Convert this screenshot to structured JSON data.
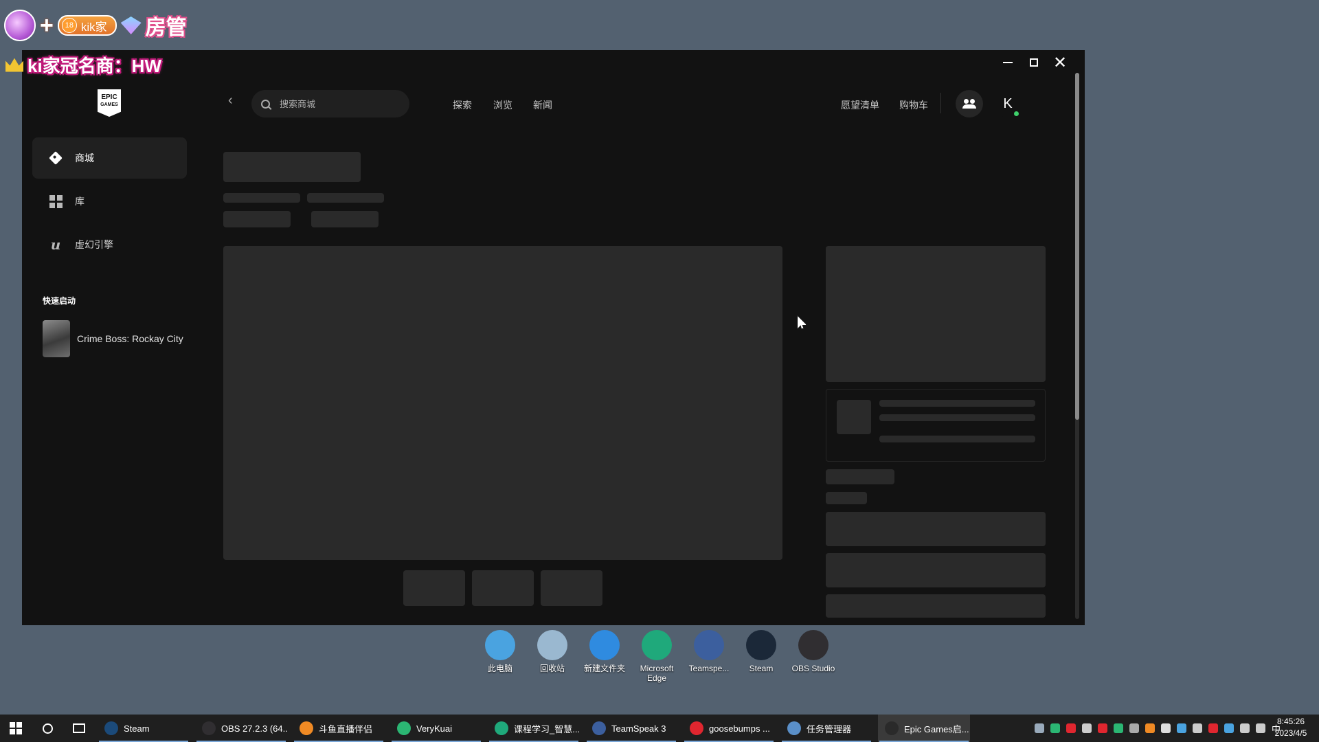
{
  "overlay": {
    "badge_level": "18",
    "badge_name": "kik家",
    "role": "房管",
    "sponsor": "ki家冠名商：HW"
  },
  "window": {
    "controls": {
      "minimize": "minimize",
      "maximize": "maximize",
      "close": "✕"
    }
  },
  "sidebar": {
    "logo_top": "EPIC",
    "logo_bottom": "GAMES",
    "items": [
      {
        "label": "商城",
        "icon": "tag-icon",
        "active": true
      },
      {
        "label": "库",
        "icon": "grid-icon",
        "active": false
      },
      {
        "label": "虚幻引擎",
        "icon": "unreal-icon",
        "active": false
      }
    ],
    "quick_launch_title": "快速启动",
    "quick_launch_items": [
      {
        "name": "Crime Boss: Rockay City"
      }
    ]
  },
  "topbar": {
    "search_placeholder": "搜索商城",
    "nav": [
      "探索",
      "浏览",
      "新闻"
    ],
    "wishlist": "愿望清单",
    "cart": "购物车",
    "avatar_letter": "K",
    "online": true
  },
  "desktop": {
    "icons": [
      {
        "label": "此电脑",
        "icon": "computer-icon",
        "color": "#4aa3e0"
      },
      {
        "label": "回收站",
        "icon": "recycle-bin-icon",
        "color": "#9ab8d0"
      },
      {
        "label": "新建文件夹",
        "icon": "star-folder-icon",
        "color": "#2f8be0"
      },
      {
        "label": "Microsoft Edge",
        "icon": "edge-icon",
        "color": "#1fa97b"
      },
      {
        "label": "Teamspe...",
        "icon": "teamspeak-icon",
        "color": "#3c5f9e"
      },
      {
        "label": "Steam",
        "icon": "steam-icon",
        "color": "#1b2838"
      },
      {
        "label": "OBS Studio",
        "icon": "obs-icon",
        "color": "#302e31"
      }
    ]
  },
  "taskbar": {
    "apps": [
      {
        "label": "Steam",
        "icon": "steam-icon",
        "color": "#1b4a7a"
      },
      {
        "label": "OBS 27.2.3 (64...",
        "icon": "obs-icon",
        "color": "#302e31"
      },
      {
        "label": "斗鱼直播伴侣",
        "icon": "douyu-icon",
        "color": "#f08a24"
      },
      {
        "label": "VeryKuai",
        "icon": "verykuai-icon",
        "color": "#2bb673"
      },
      {
        "label": "课程学习_智慧...",
        "icon": "edge-icon",
        "color": "#1fa97b"
      },
      {
        "label": "TeamSpeak 3",
        "icon": "teamspeak-icon",
        "color": "#3c5f9e"
      },
      {
        "label": "goosebumps ...",
        "icon": "netease-music-icon",
        "color": "#e0262f"
      },
      {
        "label": "任务管理器",
        "icon": "task-manager-icon",
        "color": "#5a8fc8"
      },
      {
        "label": "Epic Games启...",
        "icon": "epic-icon",
        "color": "#2a2a2a",
        "active": true
      }
    ],
    "tray_colors": [
      "#9ab",
      "#2bb673",
      "#e0262f",
      "#ccc",
      "#e0262f",
      "#2bb673",
      "#aaa",
      "#f08a24",
      "#ddd",
      "#4aa3e0",
      "#ccc",
      "#e0262f",
      "#4aa3e0",
      "#ccc",
      "#ccc"
    ],
    "ime": "中",
    "time": "8:45:26",
    "date": "2023/4/5"
  }
}
